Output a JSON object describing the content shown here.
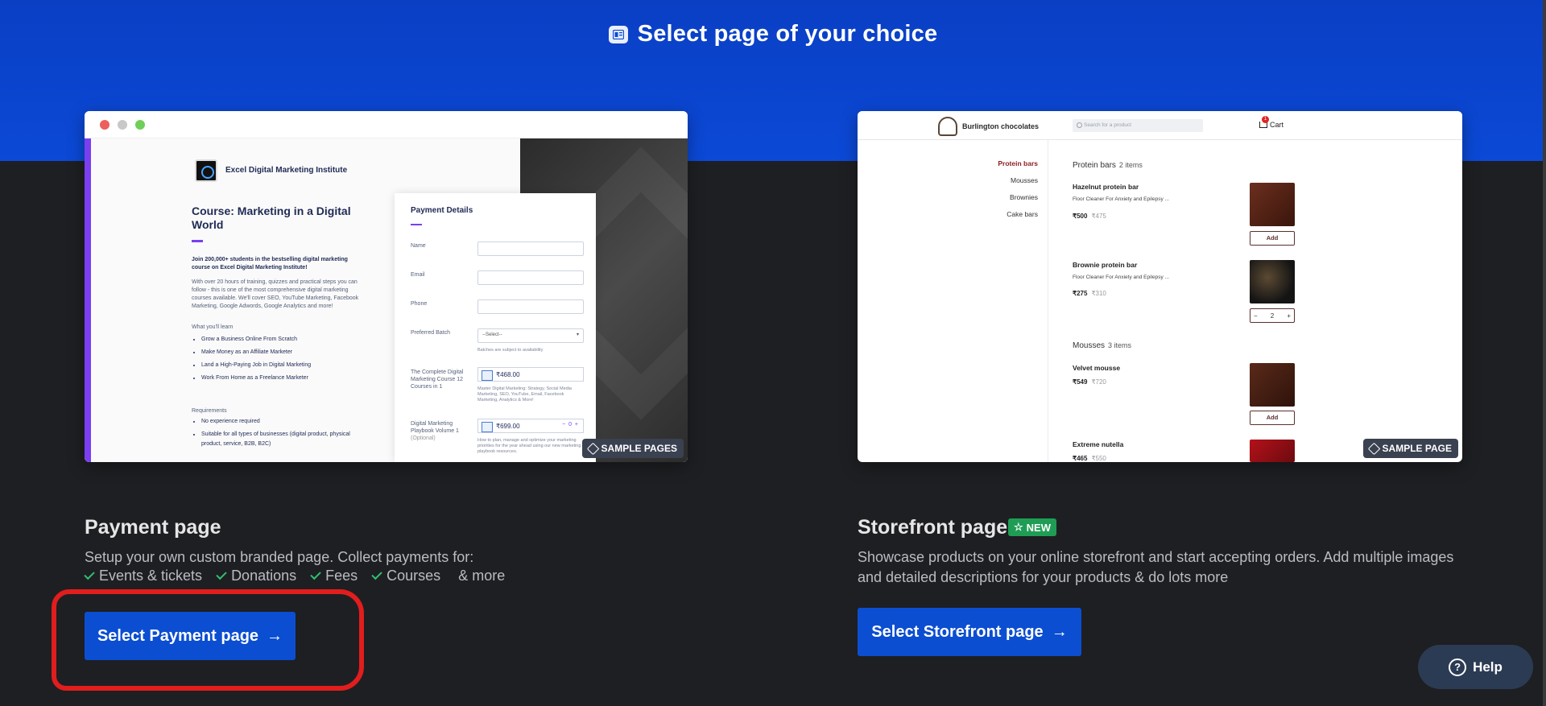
{
  "header": {
    "title": "Select page of your choice",
    "icon": "page-layout-icon"
  },
  "payment_preview": {
    "badge": "SAMPLE PAGES",
    "institute": "Excel Digital Marketing Institute",
    "course_title": "Course: Marketing in a Digital World",
    "intro": "Join 200,000+ students in the bestselling digital marketing course on Excel Digital Marketing Institute!",
    "desc": "With over 20 hours of training, quizzes and practical steps you can follow - this is one of the most comprehensive digital marketing courses available. We'll cover SEO, YouTube Marketing, Facebook Marketing, Google Adwords, Google Analytics and more!",
    "learn_heading": "What you'll learn",
    "learn_items": [
      "Grow a Business Online From Scratch",
      "Make Money as an Affiliate Marketer",
      "Land a High-Paying Job in Digital Marketing",
      "Work From Home as a Freelance Marketer"
    ],
    "req_heading": "Requirements",
    "req_items": [
      "No experience required",
      "Suitable for all types of businesses (digital product, physical product, service, B2B, B2C)"
    ],
    "payment_details": {
      "title": "Payment Details",
      "name_label": "Name",
      "email_label": "Email",
      "phone_label": "Phone",
      "batch_label": "Preferred Batch",
      "batch_value": "--Select--",
      "batch_note": "Batches are subject to availability",
      "product1_label": "The Complete Digital Marketing Course 12 Courses in 1",
      "product1_price": "₹468.00",
      "product1_note": "Master Digital Marketing: Strategy, Social Media Marketing, SEO, YouTube, Email, Facebook Marketing, Analytics & More!",
      "product2_label": "Digital Marketing Playbook Volume 1",
      "product2_optional": "(Optional)",
      "product2_price": "₹699.00",
      "product2_qty": "0",
      "product2_note": "How to plan, manage and optimize your marketing priorities for the year ahead using our new marketing playbook resources."
    }
  },
  "storefront_preview": {
    "badge": "SAMPLE PAGE",
    "brand": "Burlington chocolates",
    "search_placeholder": "Search for a product",
    "cart_label": "Cart",
    "cart_count": "1",
    "categories": [
      "Protein bars",
      "Mousses",
      "Brownies",
      "Cake bars"
    ],
    "sections": [
      {
        "name": "Protein bars",
        "count": "2 items"
      },
      {
        "name": "Mousses",
        "count": "3 items"
      }
    ],
    "products": [
      {
        "name": "Hazelnut protein bar",
        "desc": "Floor Cleaner For Anxiety and Epilepsy ...",
        "price": "₹500",
        "old_price": "₹475",
        "action": "Add"
      },
      {
        "name": "Brownie protein bar",
        "desc": "Floor Cleaner For Anxiety and Epilepsy ...",
        "price": "₹275",
        "old_price": "₹310",
        "qty": "2"
      },
      {
        "name": "Velvet mousse",
        "price": "₹549",
        "old_price": "₹720",
        "action": "Add"
      },
      {
        "name": "Extreme nutella",
        "price": "₹465",
        "old_price": "₹550"
      }
    ]
  },
  "payment_card": {
    "title": "Payment page",
    "desc": "Setup your own custom branded page. Collect payments for:",
    "features": [
      "Events & tickets",
      "Donations",
      "Fees",
      "Courses"
    ],
    "more": "& more",
    "cta": "Select Payment page"
  },
  "storefront_card": {
    "title": "Storefront page",
    "badge": "NEW",
    "desc": "Showcase products on your online storefront and start accepting orders. Add multiple images and detailed descriptions for your products & do lots more",
    "cta": "Select Storefront page"
  },
  "help": {
    "label": "Help"
  },
  "colors": {
    "brand_blue": "#0b4ed1",
    "new_green": "#1f9d55",
    "annotation_red": "#e11d1d"
  }
}
